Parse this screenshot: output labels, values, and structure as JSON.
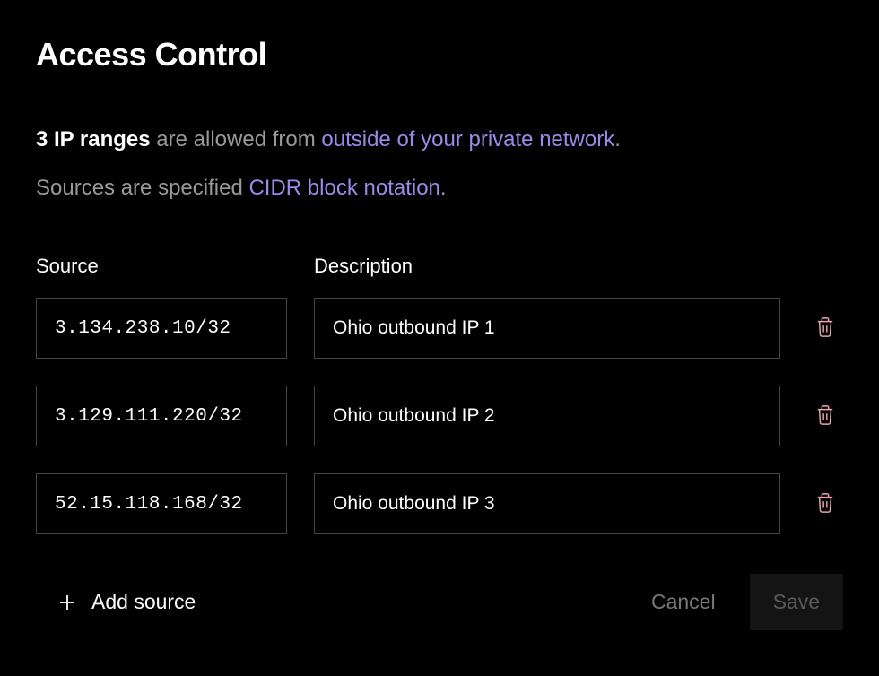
{
  "title": "Access Control",
  "summary": {
    "bold_prefix": "3 IP ranges",
    "mid_text": " are allowed from ",
    "link1": "outside of your private network",
    "suffix1": ".",
    "line2_prefix": "Sources are specified ",
    "link2": "CIDR block notation",
    "suffix2": "."
  },
  "headers": {
    "source": "Source",
    "description": "Description"
  },
  "rows": [
    {
      "source": "3.134.238.10/32",
      "description": "Ohio outbound IP 1"
    },
    {
      "source": "3.129.111.220/32",
      "description": "Ohio outbound IP 2"
    },
    {
      "source": "52.15.118.168/32",
      "description": "Ohio outbound IP 3"
    }
  ],
  "footer": {
    "add_label": "Add source",
    "cancel_label": "Cancel",
    "save_label": "Save"
  },
  "colors": {
    "trash": "#e8a3ad"
  }
}
